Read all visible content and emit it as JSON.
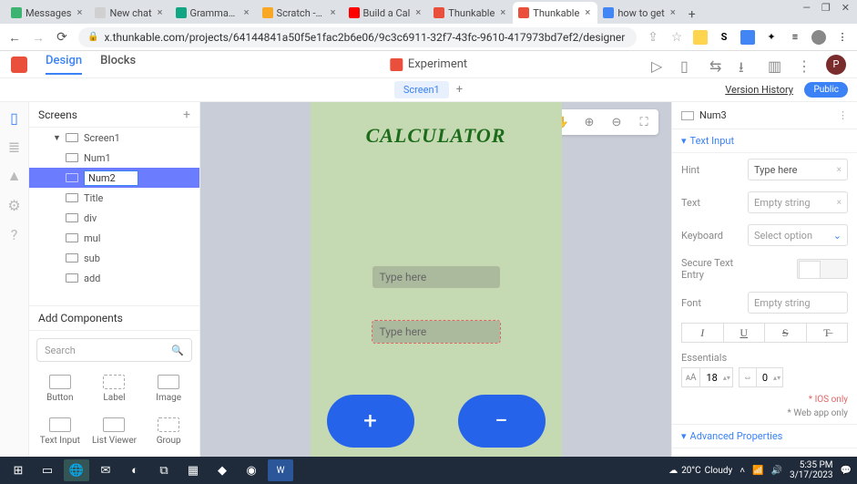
{
  "browser": {
    "tabs": [
      {
        "title": "Messages",
        "favicon": "#3cb371"
      },
      {
        "title": "New chat",
        "favicon": "#d0d0d0"
      },
      {
        "title": "Grammarl…",
        "favicon": "#11a683"
      },
      {
        "title": "Scratch - Im",
        "favicon": "#f9a825"
      },
      {
        "title": "Build a Cal",
        "favicon": "#ff0000"
      },
      {
        "title": "Thunkable",
        "favicon": "#e94f3a"
      },
      {
        "title": "Thunkable",
        "favicon": "#e94f3a",
        "active": true
      },
      {
        "title": "how to get",
        "favicon": "#4285f4"
      }
    ],
    "url": "x.thunkable.com/projects/64144841a50f5e1fac2b6e06/9c3c6911-32f7-43fc-9610-417973bd7ef2/designer"
  },
  "thunkable": {
    "tabs": {
      "design": "Design",
      "blocks": "Blocks"
    },
    "project_name": "Experiment",
    "avatar_initial": "P"
  },
  "screens_bar": {
    "screen_name": "Screen1",
    "version_history": "Version History",
    "public": "Public"
  },
  "left_panel": {
    "screens_header": "Screens",
    "tree": {
      "root": "Screen1",
      "children": [
        "Num1",
        "Num2",
        "Title",
        "div",
        "mul",
        "sub",
        "add"
      ],
      "editing_index": 1,
      "editing_value": "Num2"
    },
    "add_components": "Add Components",
    "search_placeholder": "Search",
    "components_row1": [
      "Button",
      "Label",
      "Image"
    ],
    "components_row2": [
      "Text Input",
      "List Viewer",
      "Group"
    ]
  },
  "canvas": {
    "app_title": "CALCULATOR",
    "input1_placeholder": "Type here",
    "input2_placeholder": "Type here",
    "btn_plus": "+",
    "btn_minus": "−"
  },
  "right_panel": {
    "title": "Num3",
    "section": "Text Input",
    "hint_label": "Hint",
    "hint_value": "Type here",
    "text_label": "Text",
    "text_value": "Empty string",
    "keyboard_label": "Keyboard",
    "keyboard_value": "Select option",
    "secure_label": "Secure Text Entry",
    "font_label": "Font",
    "font_value": "Empty string",
    "essentials_label": "Essentials",
    "font_size": "18",
    "spacing": "0",
    "ios_only": "* IOS only",
    "web_only": "* Web app only",
    "advanced": "Advanced Properties"
  },
  "taskbar": {
    "weather_temp": "20°C",
    "weather_cond": "Cloudy",
    "time": "5:35 PM",
    "date": "3/17/2023"
  }
}
